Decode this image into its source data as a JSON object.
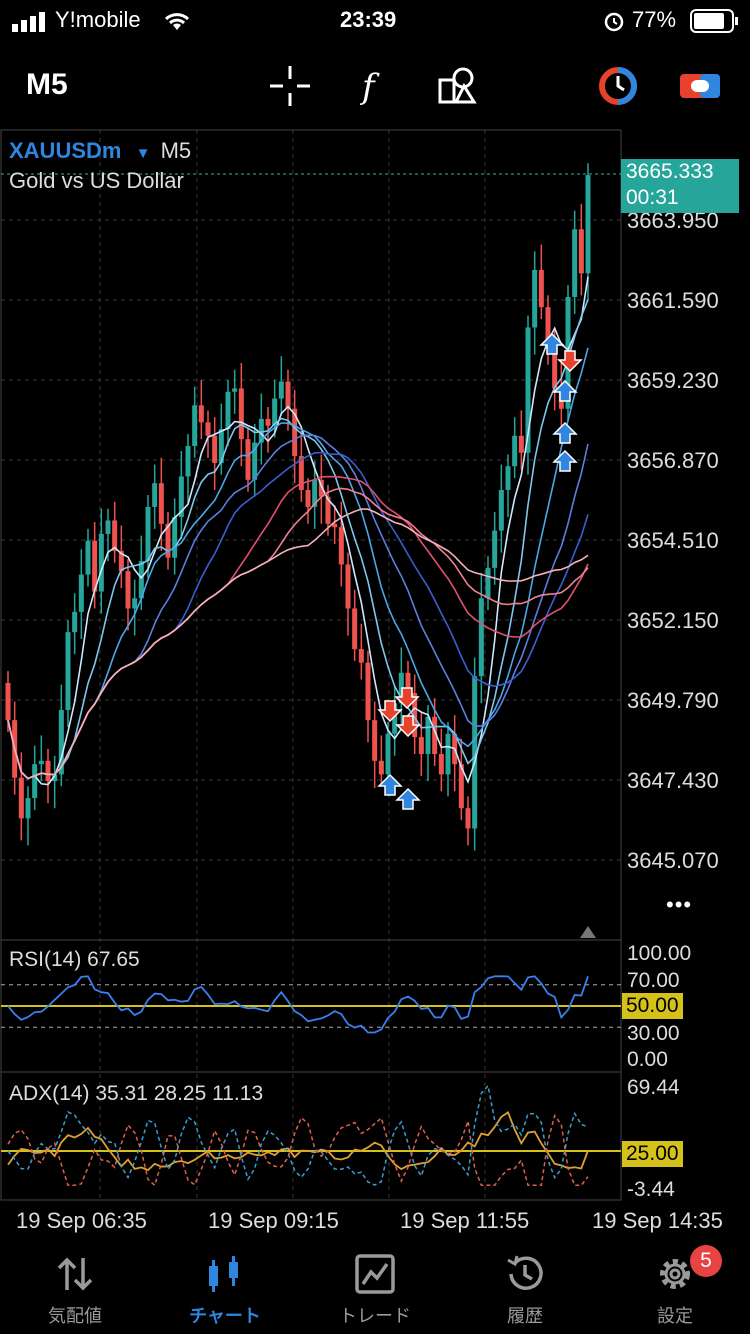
{
  "status_bar": {
    "carrier": "Y!mobile",
    "time": "23:39",
    "battery": "77%"
  },
  "toolbar": {
    "timeframe": "M5",
    "icons": [
      "crosshair-icon",
      "function-icon",
      "objects-icon",
      "account-switch-icon",
      "trade-toggle-icon"
    ]
  },
  "chart": {
    "symbol": "XAUUSDm",
    "symbol_arrow": "▼",
    "period": "M5",
    "description": "Gold vs US Dollar",
    "current_price": "3665.333",
    "countdown": "00:31",
    "price_axis": [
      "3663.950",
      "3661.590",
      "3659.230",
      "3656.870",
      "3654.510",
      "3652.150",
      "3649.790",
      "3647.430",
      "3645.070"
    ],
    "more": "•••",
    "colors": {
      "up": "#26a69a",
      "down": "#ef5350",
      "accent": "#2e86de",
      "level": "#d4c21b"
    }
  },
  "rsi": {
    "title": "RSI(14) 67.65",
    "axis": [
      "100.00",
      "70.00",
      "30.00",
      "0.00"
    ],
    "level": "50.00"
  },
  "adx": {
    "title": "ADX(14) 35.31 28.25 11.13",
    "axis_top": "69.44",
    "level": "25.00",
    "axis_bottom": "-3.44"
  },
  "time_axis": [
    "19 Sep 06:35",
    "19 Sep 09:15",
    "19 Sep 11:55",
    "19 Sep 14:35"
  ],
  "nav": {
    "items": [
      {
        "label": "気配値",
        "icon": "quotes-icon"
      },
      {
        "label": "チャート",
        "icon": "chart-icon"
      },
      {
        "label": "トレード",
        "icon": "trade-icon"
      },
      {
        "label": "履歴",
        "icon": "history-icon"
      },
      {
        "label": "設定",
        "icon": "settings-icon"
      }
    ],
    "active": "チャート",
    "settings_badge": "5"
  }
}
